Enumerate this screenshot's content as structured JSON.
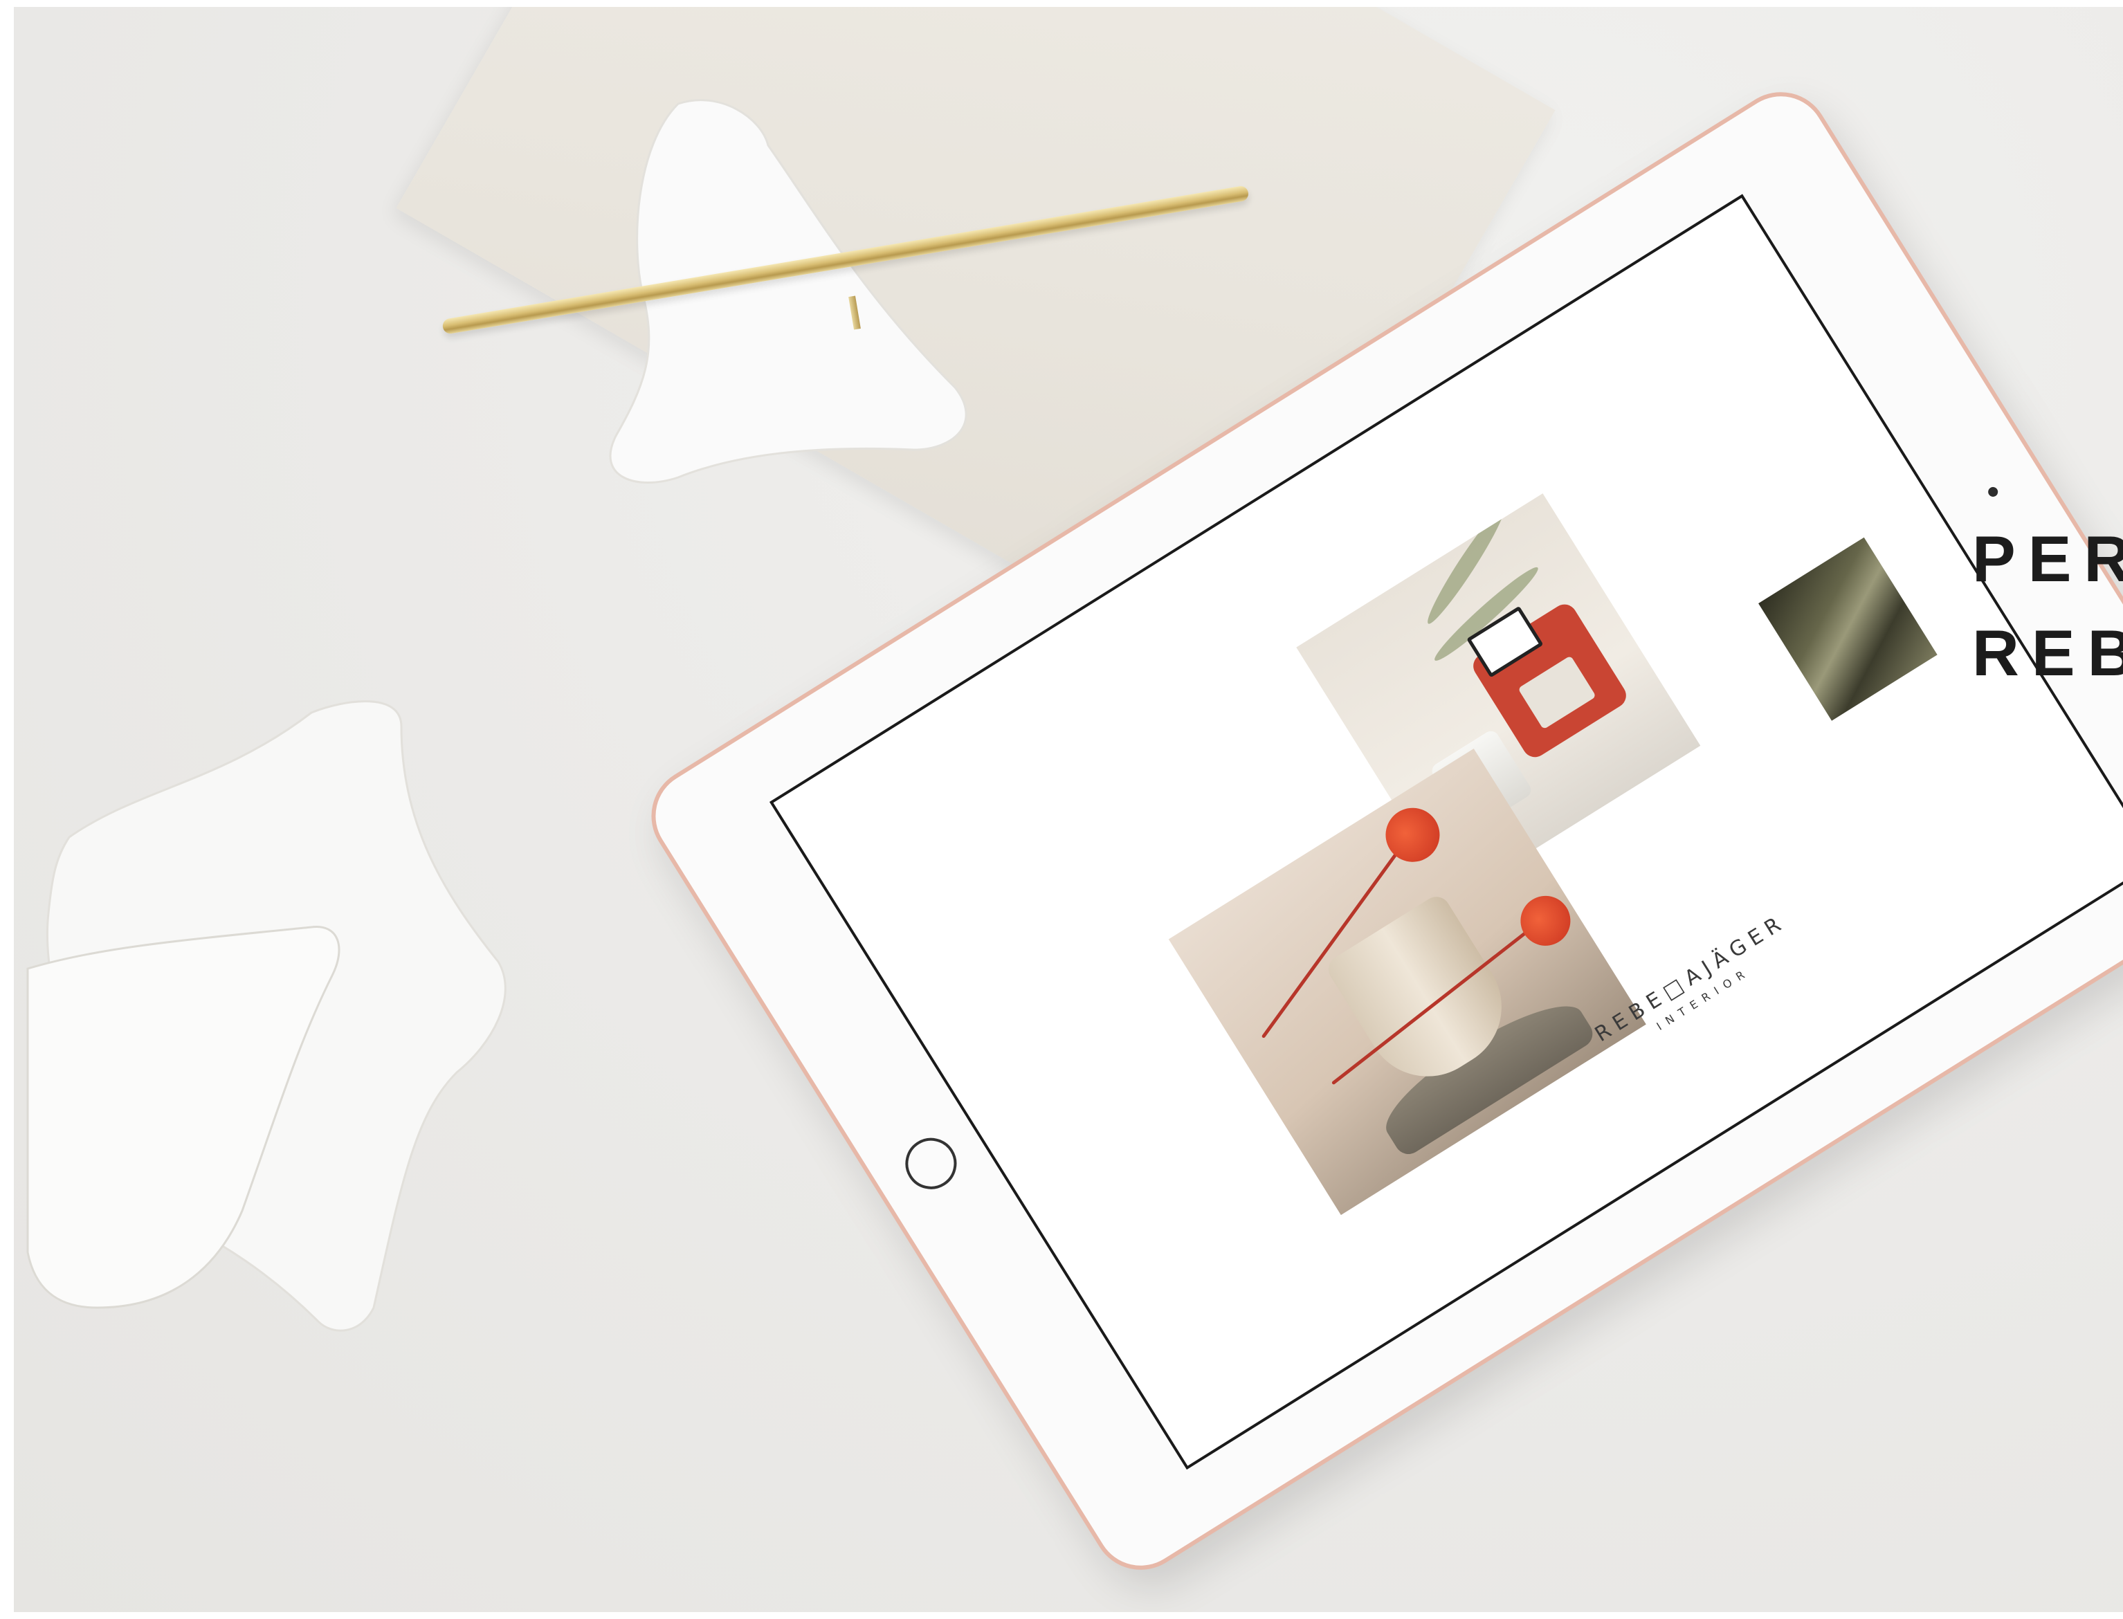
{
  "brand": {
    "name": "REBE□AJÄGER",
    "subtitle": "INTERIOR"
  },
  "headline": {
    "line1": "PER",
    "line2": "REB"
  },
  "colors": {
    "background": "#ecebe9",
    "tablet_edge": "#e7b8a8",
    "pen_gold": "#d8bd72",
    "flower_red": "#e14a2e",
    "chair_red": "#c94533"
  }
}
